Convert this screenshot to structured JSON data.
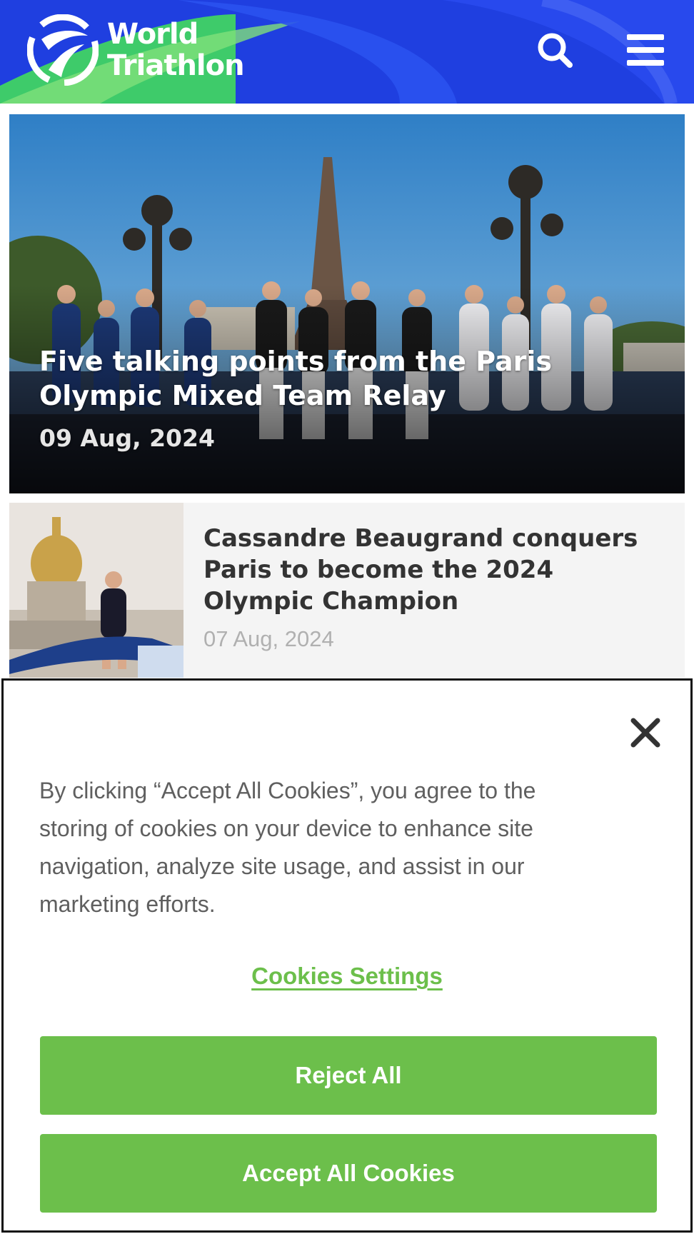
{
  "header": {
    "logo_line1": "World",
    "logo_line2": "Triathlon",
    "icons": {
      "search": "search-icon",
      "menu": "hamburger-menu-icon",
      "logo": "world-triathlon-logo-icon"
    }
  },
  "featured_article": {
    "title": "Five talking points from the Paris Olympic Mixed Team Relay",
    "date": "09 Aug, 2024"
  },
  "articles": [
    {
      "title": "Cassandre Beaugrand conquers Paris to become the 2024 Olympic Champion",
      "date": "07 Aug, 2024"
    }
  ],
  "cookie_banner": {
    "text": "By clicking “Accept All Cookies”, you agree to the storing of cookies on your device to enhance site navigation, analyze site usage, and assist in our marketing efforts.",
    "settings_link": "Cookies Settings",
    "reject_button": "Reject All",
    "accept_button": "Accept All Cookies",
    "close_icon": "close-icon"
  },
  "colors": {
    "header_blue": "#1f3fe0",
    "brand_green": "#6cbf4b",
    "text_gray": "#5f5f5f"
  }
}
